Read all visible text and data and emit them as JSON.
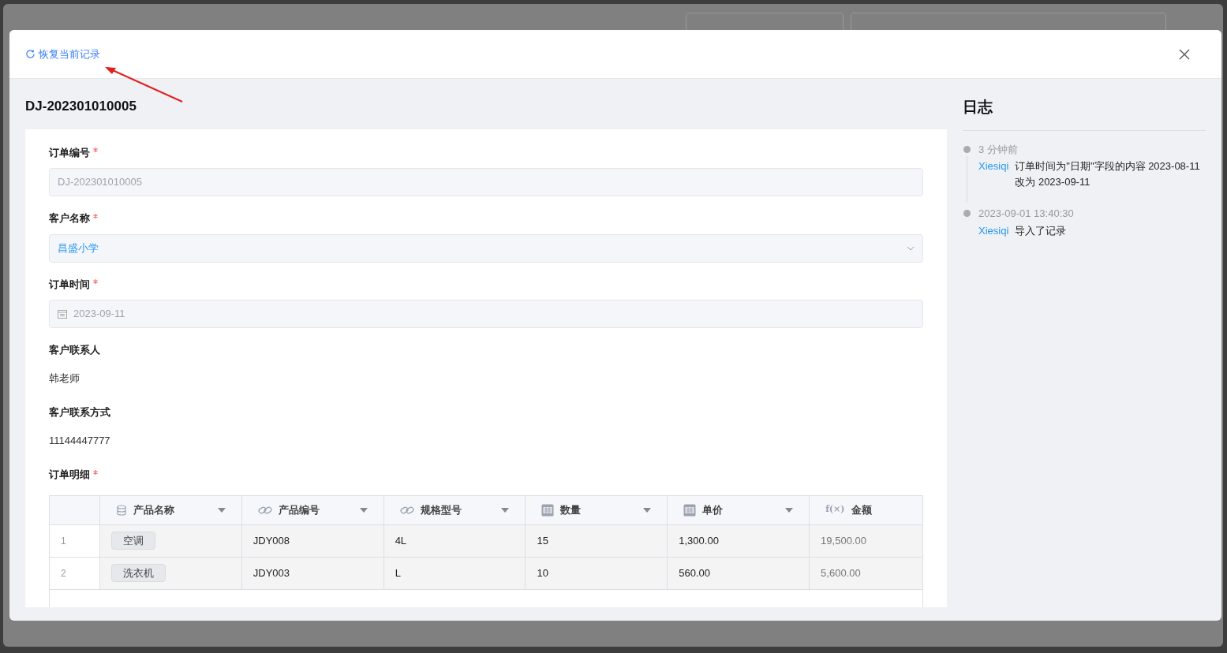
{
  "dialog": {
    "restore_link": "恢复当前记录",
    "record_title": "DJ-202301010005",
    "fields": [
      {
        "kind": "input",
        "label": "订单编号",
        "required": true,
        "value": "DJ-202301010005",
        "disabled": true
      },
      {
        "kind": "select",
        "label": "客户名称",
        "required": true,
        "value": "昌盛小学",
        "disabled": false
      },
      {
        "kind": "date",
        "label": "订单时间",
        "required": true,
        "value": "2023-09-11",
        "disabled": true
      },
      {
        "kind": "text",
        "label": "客户联系人",
        "required": false,
        "value": "韩老师"
      },
      {
        "kind": "text",
        "label": "客户联系方式",
        "required": false,
        "value": "11144447777"
      }
    ],
    "table": {
      "label": "订单明细",
      "required": true,
      "columns": [
        {
          "kind": "lookup",
          "label": "产品名称",
          "sortable": true
        },
        {
          "kind": "link",
          "label": "产品编号",
          "sortable": true
        },
        {
          "kind": "link",
          "label": "规格型号",
          "sortable": true
        },
        {
          "kind": "number",
          "label": "数量",
          "sortable": true
        },
        {
          "kind": "number",
          "label": "单价",
          "sortable": true
        },
        {
          "kind": "formula",
          "label": "金额",
          "sortable": false,
          "icon_label": "f(×)"
        }
      ],
      "rows": [
        {
          "index": "1",
          "cells": [
            "空调",
            "JDY008",
            "4L",
            "15",
            "1,300.00",
            "19,500.00"
          ]
        },
        {
          "index": "2",
          "cells": [
            "洗衣机",
            "JDY003",
            "L",
            "10",
            "560.00",
            "5,600.00"
          ]
        }
      ]
    }
  },
  "log": {
    "title": "日志",
    "entries": [
      {
        "time": "3 分钟前",
        "user": "Xiesiqi",
        "text": "订单时间为\"日期\"字段的内容 2023-08-11 改为 2023-09-11"
      },
      {
        "time": "2023-09-01 13:40:30",
        "user": "Xiesiqi",
        "text": "导入了记录"
      }
    ]
  }
}
